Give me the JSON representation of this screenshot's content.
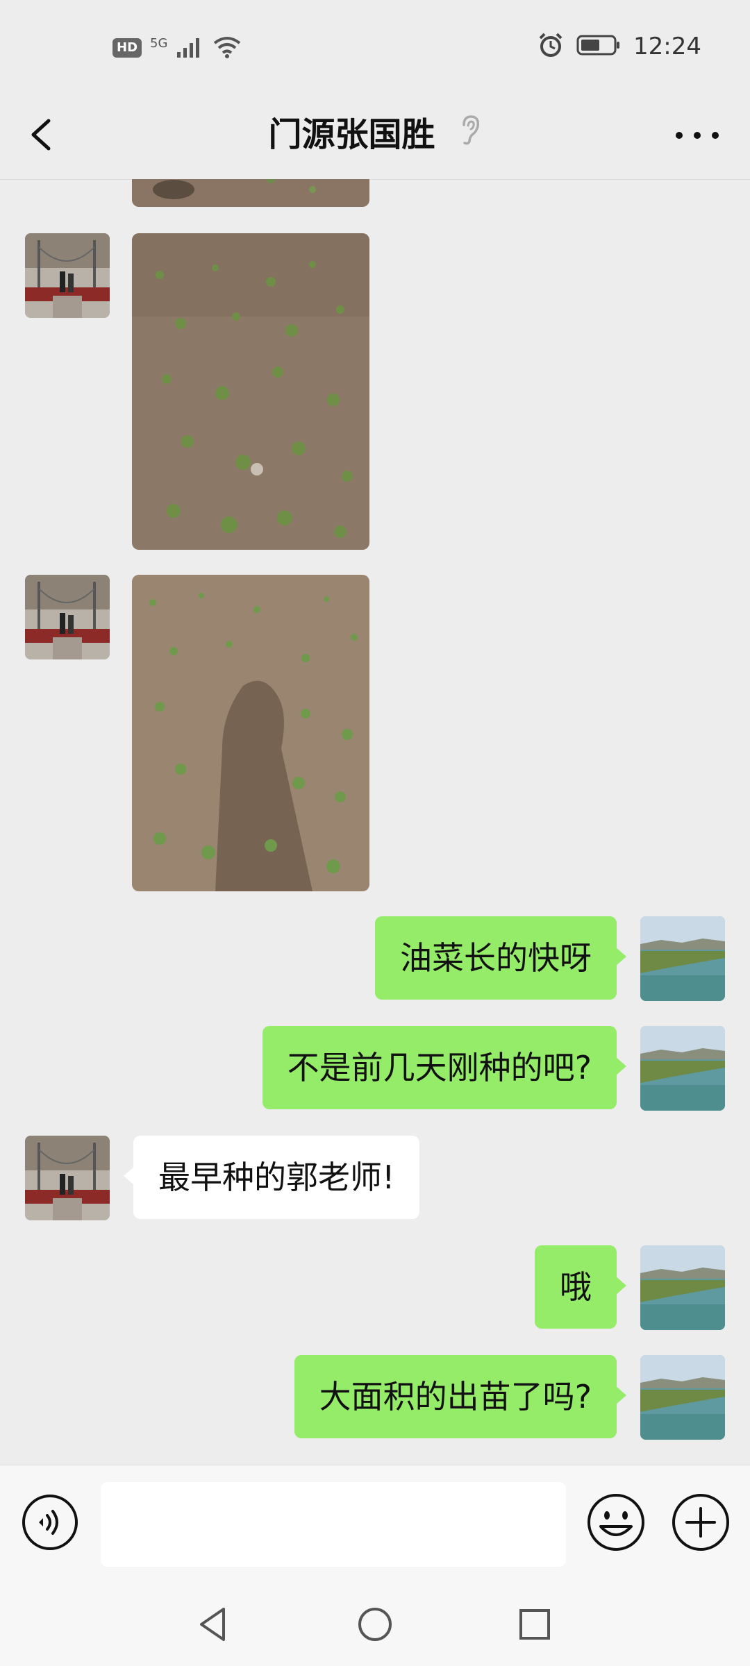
{
  "status_bar": {
    "hd": "HD",
    "network": "5G",
    "time": "12:24",
    "icons": [
      "signal-icon",
      "wifi-icon",
      "alarm-icon",
      "battery-icon"
    ]
  },
  "header": {
    "title": "门源张国胜",
    "icons": [
      "back-arrow-icon",
      "ear-icon",
      "more-dots-icon"
    ]
  },
  "messages": [
    {
      "type": "image",
      "direction": "in",
      "content": "photo of rapeseed seedlings in soil (cropped top)"
    },
    {
      "type": "image",
      "direction": "in",
      "content": "photo of rapeseed seedlings in soil"
    },
    {
      "type": "image",
      "direction": "in",
      "content": "photo of rapeseed seedlings with a shadow"
    },
    {
      "type": "text",
      "direction": "out",
      "text": "油菜长的快呀"
    },
    {
      "type": "text",
      "direction": "out",
      "text": "不是前几天刚种的吧?"
    },
    {
      "type": "text",
      "direction": "in",
      "text": "最早种的郭老师!"
    },
    {
      "type": "text",
      "direction": "out",
      "text": "哦"
    },
    {
      "type": "text",
      "direction": "out",
      "text": "大面积的出苗了吗?"
    }
  ],
  "input_bar": {
    "value": "",
    "icons": [
      "voice-icon",
      "emoji-icon",
      "plus-icon"
    ]
  },
  "nav_bar": {
    "icons": [
      "nav-back-icon",
      "nav-home-icon",
      "nav-recent-icon"
    ]
  },
  "colors": {
    "background": "#ededed",
    "outgoing_bubble": "#95ec69",
    "incoming_bubble": "#ffffff",
    "input_bar": "#f7f7f7"
  }
}
